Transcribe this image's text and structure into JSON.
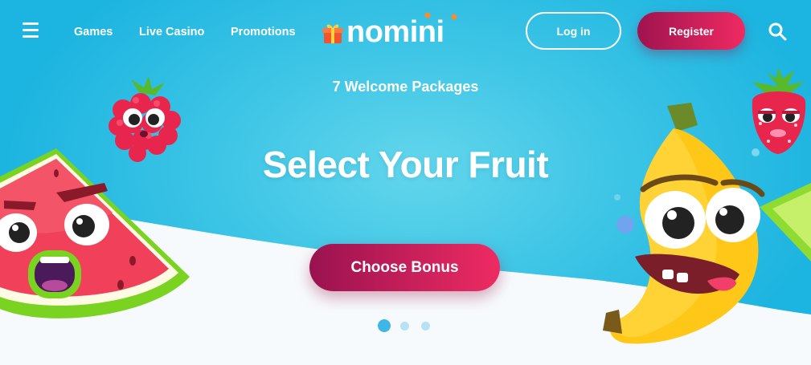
{
  "header": {
    "menu_icon": "hamburger-menu-icon",
    "nav": [
      {
        "label": "Games"
      },
      {
        "label": "Live Casino"
      },
      {
        "label": "Promotions"
      }
    ],
    "logo": {
      "text": "nomini",
      "icon": "gift-box-icon"
    },
    "login_label": "Log in",
    "register_label": "Register",
    "search_icon": "search-icon"
  },
  "hero": {
    "subtitle": "7 Welcome Packages",
    "title": "Select Your Fruit",
    "cta_label": "Choose Bonus",
    "carousel": {
      "slides": 3,
      "active": 1
    }
  },
  "colors": {
    "sky": "#1cb4e0",
    "accent_start": "#9a1250",
    "accent_end": "#ee2b62",
    "text": "#ffffff"
  }
}
